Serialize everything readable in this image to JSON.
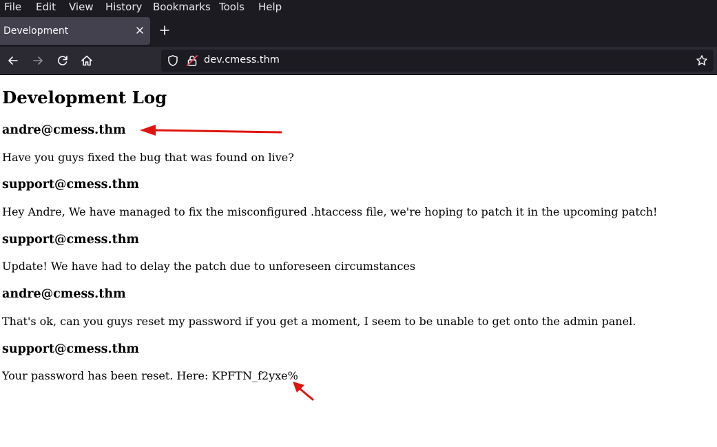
{
  "menubar": {
    "items": [
      {
        "label": "File"
      },
      {
        "label": "Edit"
      },
      {
        "label": "View"
      },
      {
        "label": "History"
      },
      {
        "label": "Bookmarks"
      },
      {
        "label": "Tools"
      },
      {
        "label": "Help"
      }
    ]
  },
  "tabs": [
    {
      "title": "Development",
      "active": true
    }
  ],
  "navbar": {
    "url": "dev.cmess.thm",
    "icons": [
      "back-icon",
      "forward-icon",
      "reload-icon",
      "home-icon",
      "shield-icon",
      "lock-icon",
      "star-icon"
    ]
  },
  "page": {
    "title": "Development Log",
    "entries": [
      {
        "author": "andre@cmess.thm",
        "message": "Have you guys fixed the bug that was found on live?"
      },
      {
        "author": "support@cmess.thm",
        "message": "Hey Andre, We have managed to fix the misconfigured .htaccess file, we're hoping to patch it in the upcoming patch!"
      },
      {
        "author": "support@cmess.thm",
        "message": "Update! We have had to delay the patch due to unforeseen circumstances"
      },
      {
        "author": "andre@cmess.thm",
        "message": "That's ok, can you guys reset my password if you get a moment, I seem to be unable to get onto the admin panel."
      },
      {
        "author": "support@cmess.thm",
        "message": "Your password has been reset. Here: KPFTN_f2yxe%"
      }
    ]
  },
  "annotations": {
    "arrow_color": "#e0140f"
  },
  "colors": {
    "chrome_dark": "#1c1b22",
    "tab_active": "#42414d",
    "navbar": "#2b2a33"
  }
}
